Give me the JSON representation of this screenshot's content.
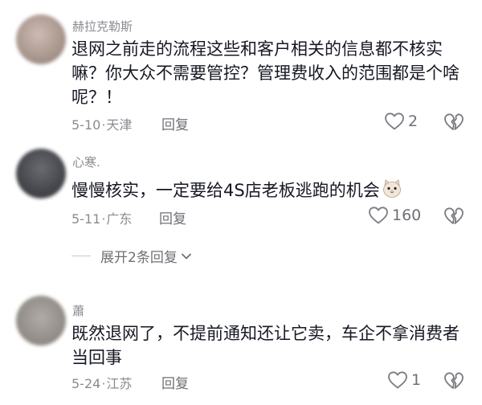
{
  "comments": [
    {
      "username": "赫拉克勒斯",
      "text": "退网之前走的流程这些和客户相关的信息都不核实嘛？你大众不需要管控？管理费收入的范围都是个啥呢？！",
      "date": "5-10",
      "location": "天津",
      "reply_label": "回复",
      "likes": "2",
      "avatar_color": "#b9a7a0"
    },
    {
      "username": "心寒.",
      "text": "慢慢核实，一定要给4S店老板逃跑的机会",
      "date": "5-11",
      "location": "广东",
      "reply_label": "回复",
      "likes": "160",
      "avatar_color": "#54555a"
    },
    {
      "username": "蕭",
      "text": "既然退网了，不提前通知还让它卖，车企不拿消费者当回事",
      "date": "5-24",
      "location": "江苏",
      "reply_label": "回复",
      "likes": "1",
      "avatar_color": "#9a9692"
    }
  ],
  "expand_replies": {
    "label": "展开2条回复"
  },
  "colors": {
    "muted": "#8a8b91",
    "text": "#161823"
  },
  "icons": {
    "like": "heart-outline-icon",
    "dislike": "broken-heart-icon",
    "expand": "chevron-down-icon",
    "emoji": "cat-face-emoji"
  }
}
